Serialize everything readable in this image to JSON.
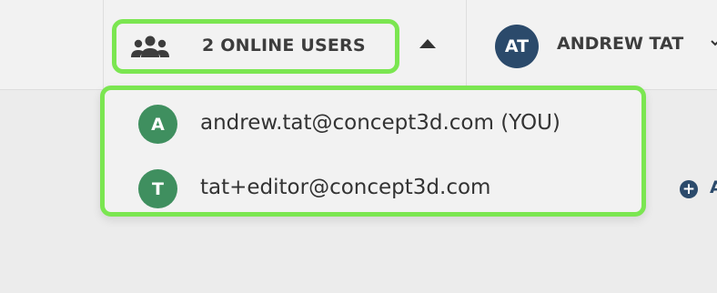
{
  "topbar": {
    "online_users": {
      "label": "2 ONLINE USERS",
      "icon": "users-icon",
      "expanded": true
    },
    "account": {
      "initials": "AT",
      "name": "ANDREW TAT",
      "avatar_color": "#2b4a6b"
    }
  },
  "online_users_list": [
    {
      "initial": "A",
      "email": "andrew.tat@concept3d.com (YOU)"
    },
    {
      "initial": "T",
      "email": "tat+editor@concept3d.com"
    }
  ],
  "background_controls": {
    "add_icon": "plus-circle-icon",
    "add_label_fragment": "A"
  },
  "colors": {
    "highlight": "#7be651",
    "user_avatar": "#3f8f5f",
    "accent": "#2b4a6b"
  }
}
